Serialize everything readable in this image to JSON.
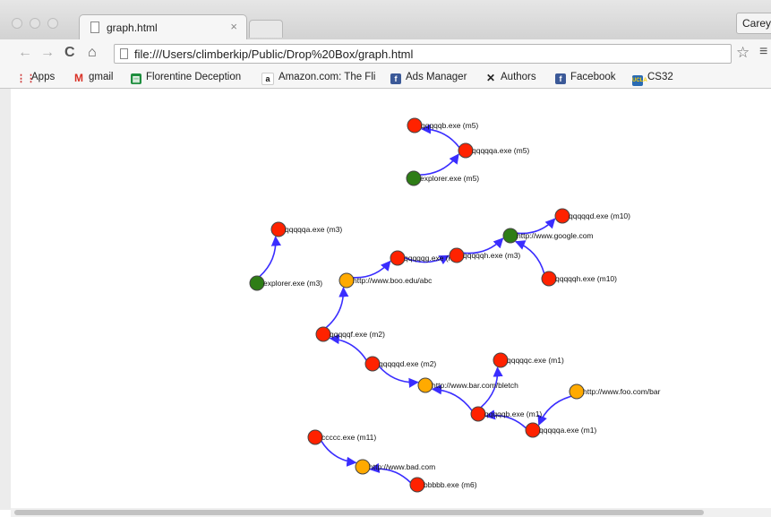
{
  "browser": {
    "tab_title": "graph.html",
    "tab_close": "×",
    "user_name": "Carey",
    "url": "file:///Users/climberkip/Public/Drop%20Box/graph.html"
  },
  "bookmarks": [
    {
      "label": "Apps",
      "icon": "apps-grid-icon"
    },
    {
      "label": "gmail",
      "icon": "gmail-icon"
    },
    {
      "label": "Florentine Deception",
      "icon": "sheets-icon"
    },
    {
      "label": "Amazon.com: The Fli",
      "icon": "amazon-icon"
    },
    {
      "label": "Ads Manager",
      "icon": "facebook-icon"
    },
    {
      "label": "Authors",
      "icon": "x-icon"
    },
    {
      "label": "Facebook",
      "icon": "facebook-icon"
    },
    {
      "label": "CS32",
      "icon": "ucla-icon"
    }
  ],
  "colors": {
    "process": "#ff2200",
    "url": "#ffaa00",
    "root": "#2e7d16",
    "edge": "#3a2dff"
  },
  "graph": {
    "nodes": [
      {
        "id": "qqqqqb.exe (m5)",
        "kind": "process"
      },
      {
        "id": "qqqqqa.exe (m5)",
        "kind": "process"
      },
      {
        "id": "explorer.exe (m5)",
        "kind": "root"
      },
      {
        "id": "qqqqqa.exe (m3)",
        "kind": "process"
      },
      {
        "id": "explorer.exe (m3)",
        "kind": "root"
      },
      {
        "id": "http://www.boo.edu/abc",
        "kind": "url"
      },
      {
        "id": "qqqqqg.exe (m3)",
        "kind": "process"
      },
      {
        "id": "qqqqqh.exe (m3)",
        "kind": "process"
      },
      {
        "id": "http://www.google.com",
        "kind": "root"
      },
      {
        "id": "qqqqqd.exe (m10)",
        "kind": "process"
      },
      {
        "id": "qqqqqh.exe (m10)",
        "kind": "process"
      },
      {
        "id": "qqqqqf.exe (m2)",
        "kind": "process"
      },
      {
        "id": "qqqqqd.exe (m2)",
        "kind": "process"
      },
      {
        "id": "http://www.bar.com/bletch",
        "kind": "url"
      },
      {
        "id": "qqqqqc.exe (m1)",
        "kind": "process"
      },
      {
        "id": "http://www.foo.com/bar",
        "kind": "url"
      },
      {
        "id": "qqqqqb.exe (m1)",
        "kind": "process"
      },
      {
        "id": "qqqqqa.exe (m1)",
        "kind": "process"
      },
      {
        "id": "ccccc.exe (m11)",
        "kind": "process"
      },
      {
        "id": "http://www.bad.com",
        "kind": "url"
      },
      {
        "id": "bbbbb.exe (m6)",
        "kind": "process"
      }
    ],
    "edges": [
      {
        "from": "explorer.exe (m5)",
        "to": "qqqqqa.exe (m5)"
      },
      {
        "from": "qqqqqa.exe (m5)",
        "to": "qqqqqb.exe (m5)"
      },
      {
        "from": "explorer.exe (m3)",
        "to": "qqqqqa.exe (m3)"
      },
      {
        "from": "http://www.boo.edu/abc",
        "to": "qqqqqg.exe (m3)"
      },
      {
        "from": "qqqqqg.exe (m3)",
        "to": "qqqqqh.exe (m3)"
      },
      {
        "from": "qqqqqh.exe (m3)",
        "to": "http://www.google.com"
      },
      {
        "from": "http://www.google.com",
        "to": "qqqqqd.exe (m10)"
      },
      {
        "from": "qqqqqh.exe (m10)",
        "to": "http://www.google.com"
      },
      {
        "from": "qqqqqf.exe (m2)",
        "to": "http://www.boo.edu/abc"
      },
      {
        "from": "qqqqqd.exe (m2)",
        "to": "qqqqqf.exe (m2)"
      },
      {
        "from": "qqqqqd.exe (m2)",
        "to": "http://www.bar.com/bletch"
      },
      {
        "from": "qqqqqb.exe (m1)",
        "to": "http://www.bar.com/bletch"
      },
      {
        "from": "qqqqqb.exe (m1)",
        "to": "qqqqqc.exe (m1)"
      },
      {
        "from": "qqqqqa.exe (m1)",
        "to": "qqqqqb.exe (m1)"
      },
      {
        "from": "http://www.foo.com/bar",
        "to": "qqqqqa.exe (m1)"
      },
      {
        "from": "ccccc.exe (m11)",
        "to": "http://www.bad.com"
      },
      {
        "from": "bbbbb.exe (m6)",
        "to": "http://www.bad.com"
      }
    ]
  }
}
